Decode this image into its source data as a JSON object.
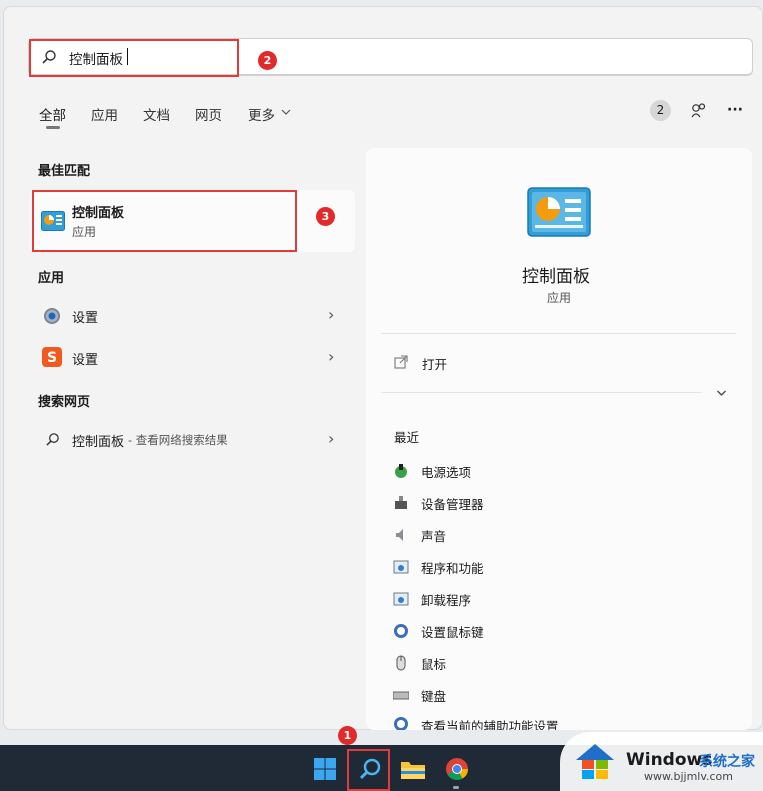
{
  "search": {
    "value": "控制面板"
  },
  "tabs": [
    {
      "label": "全部",
      "active": true
    },
    {
      "label": "应用"
    },
    {
      "label": "文档"
    },
    {
      "label": "网页"
    },
    {
      "label": "更多"
    }
  ],
  "header_right": {
    "count": "2",
    "more": "···"
  },
  "best_match": {
    "heading": "最佳匹配",
    "title": "控制面板",
    "subtitle": "应用"
  },
  "apps": {
    "heading": "应用",
    "items": [
      {
        "label": "设置",
        "icon": "gear-icon"
      },
      {
        "label": "设置",
        "icon": "sogou-s-icon"
      }
    ]
  },
  "web": {
    "heading": "搜索网页",
    "query": "控制面板",
    "suffix": " - 查看网络搜索结果"
  },
  "detail": {
    "title": "控制面板",
    "subtitle": "应用",
    "open_label": "打开",
    "recent_heading": "最近",
    "recent": [
      "电源选项",
      "设备管理器",
      "声音",
      "程序和功能",
      "卸载程序",
      "设置鼠标键",
      "鼠标",
      "键盘",
      "查看当前的辅助功能设置"
    ]
  },
  "annotations": [
    "1",
    "2",
    "3"
  ],
  "watermark": {
    "brand": "Windows",
    "site_cn": "系统之家",
    "url": "www.bjjmlv.com"
  },
  "colors": {
    "accent": "#0067c0",
    "annotation": "#e23b3b",
    "taskbar": "#1f2a36"
  }
}
